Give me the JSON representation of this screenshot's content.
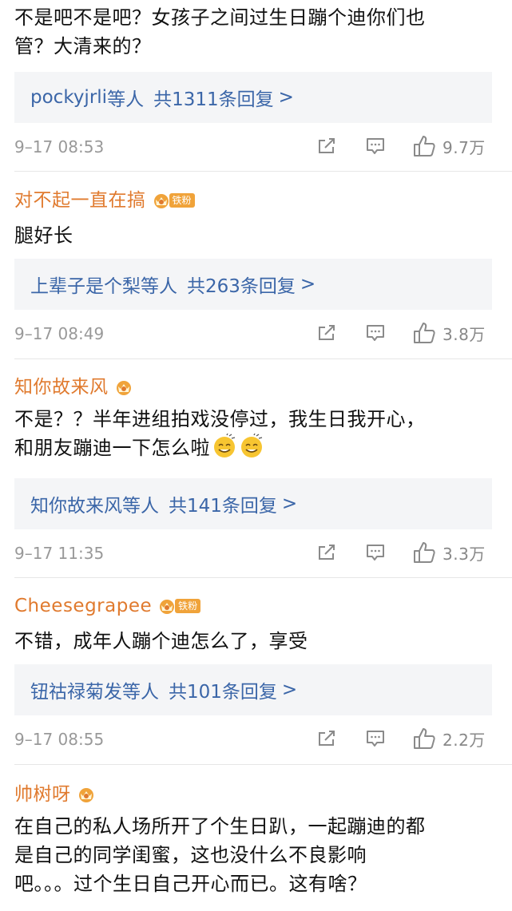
{
  "comments": [
    {
      "username": "",
      "text_lines": [
        "不是吧不是吧？女孩子之间过生日蹦个迪你们也",
        "管？大清来的？"
      ],
      "reply_names": "pockyjrli",
      "reply_suffix": "等人",
      "reply_count": "共1311条回复",
      "reply_arrow": ">",
      "time": "9–17 08:53",
      "likes": "9.7万"
    },
    {
      "username": "对不起一直在搞",
      "badge_text": "铁粉",
      "text_lines": [
        "腿好长"
      ],
      "reply_names": "上辈子是个梨",
      "reply_suffix": "等人",
      "reply_count": "共263条回复",
      "reply_arrow": ">",
      "time": "9–17 08:49",
      "likes": "3.8万"
    },
    {
      "username": "知你故来风",
      "badge_text": "",
      "text_lines": [
        "不是？？半年进组拍戏没停过，我生日我开心，",
        "和朋友蹦迪一下怎么啦"
      ],
      "emoji_count": 2,
      "reply_names": "知你故来风",
      "reply_suffix": "等人",
      "reply_count": "共141条回复",
      "reply_arrow": ">",
      "time": "9–17 11:35",
      "likes": "3.3万"
    },
    {
      "username": "Cheesegrapee",
      "badge_text": "铁粉",
      "text_lines": [
        "不错，成年人蹦个迪怎么了，享受"
      ],
      "reply_names": "钮祜禄菊发",
      "reply_suffix": "等人",
      "reply_count": "共101条回复",
      "reply_arrow": ">",
      "time": "9–17 08:55",
      "likes": "2.2万"
    },
    {
      "username": "帅树呀",
      "badge_text": "",
      "text_lines": [
        "在自己的私人场所开了个生日趴，一起蹦迪的都",
        "是自己的同学闺蜜，这也没什么不良影响",
        "吧。。。过个生日自己开心而已。这有啥？"
      ]
    }
  ],
  "icons": {
    "repost": "repost-icon",
    "comment": "comment-icon",
    "like": "thumbs-up-icon",
    "fan_badge": "fan-crown-badge-icon",
    "emoji": "sweat-smile-emoji"
  },
  "colors": {
    "username": "#e07a2e",
    "reply_link": "#3b66a8",
    "reply_bg": "#f4f5f7",
    "meta": "#999999",
    "badge": "#f0a33a"
  }
}
